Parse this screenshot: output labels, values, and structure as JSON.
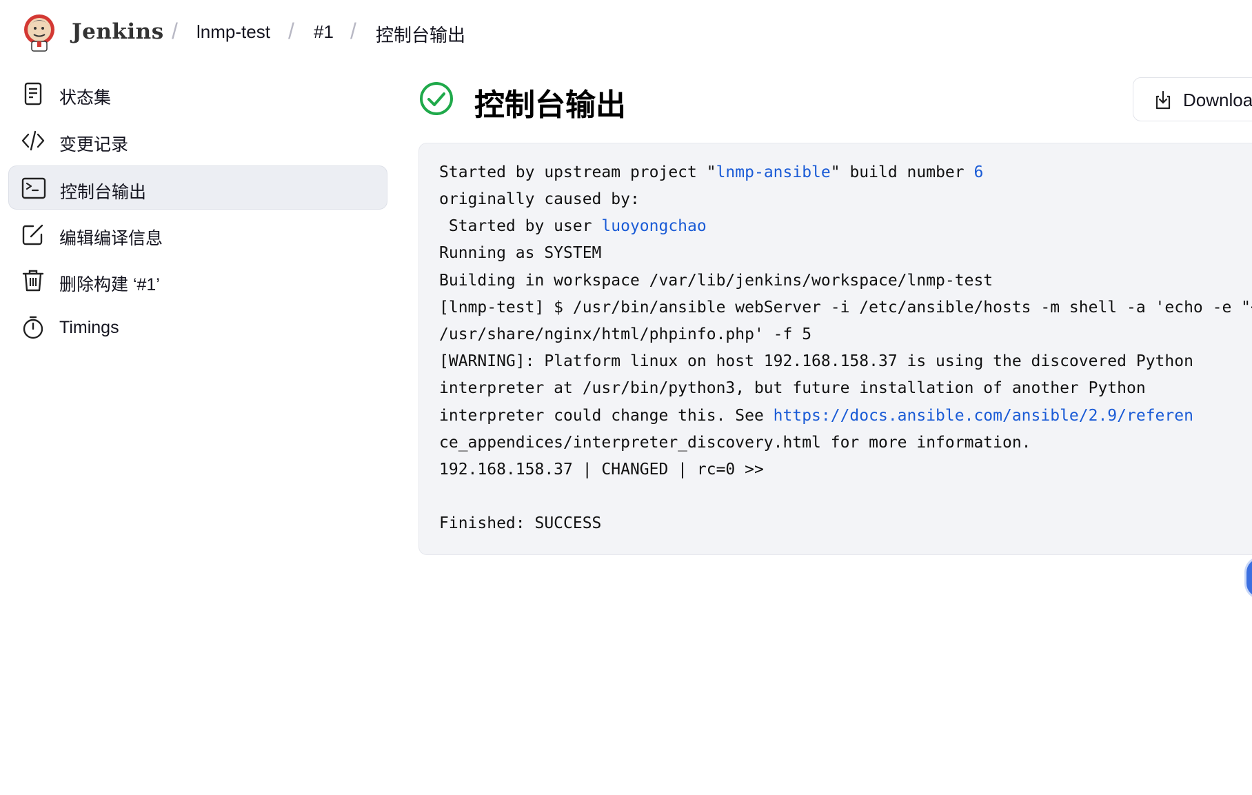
{
  "header": {
    "brand": "Jenkins",
    "breadcrumbs": [
      "lnmp-test",
      "#1",
      "控制台输出"
    ],
    "separator": "/"
  },
  "sidebar": {
    "items": [
      {
        "label": "状态集",
        "icon": "document-icon",
        "active": false
      },
      {
        "label": "变更记录",
        "icon": "code-icon",
        "active": false
      },
      {
        "label": "控制台输出",
        "icon": "terminal-icon",
        "active": true
      },
      {
        "label": "编辑编译信息",
        "icon": "edit-icon",
        "active": false
      },
      {
        "label": "删除构建 ‘#1’",
        "icon": "trash-icon",
        "active": false
      },
      {
        "label": "Timings",
        "icon": "stopwatch-icon",
        "active": false
      }
    ]
  },
  "main": {
    "status_icon": "success-check-icon",
    "title": "控制台输出",
    "download_label": "Downloa"
  },
  "console": {
    "line1": {
      "a": "Started by upstream project \"",
      "link": "lnmp-ansible",
      "b": "\" build number ",
      "link2": "6"
    },
    "line2": "originally caused by:",
    "line3": {
      "a": " Started by user ",
      "link": "luoyongchao"
    },
    "line4": "Running as SYSTEM",
    "line5": "Building in workspace /var/lib/jenkins/workspace/lnmp-test",
    "line6": "[lnmp-test] $ /usr/bin/ansible webServer -i /etc/ansible/hosts -m shell -a 'echo -e \"<?php\\",
    "line7": "/usr/share/nginx/html/phpinfo.php' -f 5",
    "line8": "[WARNING]: Platform linux on host 192.168.158.37 is using the discovered Python",
    "line9": "interpreter at /usr/bin/python3, but future installation of another Python",
    "line10": {
      "a": "interpreter could change this. See ",
      "link": "https://docs.ansible.com/ansible/2.9/referen"
    },
    "line11": "ce_appendices/interpreter_discovery.html for more information.",
    "line12": "192.168.158.37 | CHANGED | rc=0 >>",
    "line13": "Finished: SUCCESS"
  },
  "colors": {
    "link": "#1a5bd6",
    "success": "#1fa94a",
    "active_bg": "#eceef3",
    "console_bg": "#f3f4f7"
  }
}
